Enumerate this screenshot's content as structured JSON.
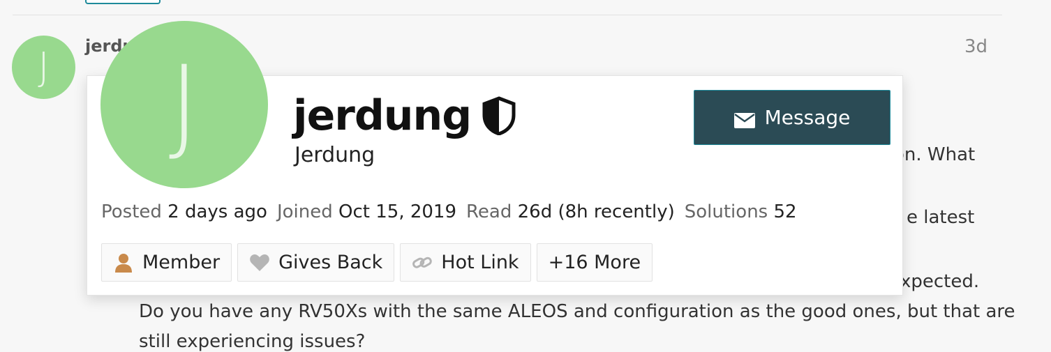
{
  "post": {
    "avatar_letter": "J",
    "username": "jerdung",
    "time": "3d",
    "body_lines": [
      "on. What",
      "e latest",
      "xpected.",
      "Do you have any RV50Xs with the same ALEOS and configuration as the good ones, but that are",
      "still experiencing issues?"
    ]
  },
  "user_card": {
    "avatar_letter": "J",
    "username": "jerdung",
    "full_name": "Jerdung",
    "message_label": "Message",
    "stats": {
      "posted_label": "Posted",
      "posted_value": "2 days ago",
      "joined_label": "Joined",
      "joined_value": "Oct 15, 2019",
      "read_label": "Read",
      "read_value": "26d (8h recently)",
      "solutions_label": "Solutions",
      "solutions_value": "52"
    },
    "badges": [
      {
        "label": "Member",
        "icon": "person-icon",
        "color": "#c98a4b"
      },
      {
        "label": "Gives Back",
        "icon": "heart-icon",
        "color": "#b5b5b5"
      },
      {
        "label": "Hot Link",
        "icon": "link-icon",
        "color": "#b5b5b5"
      },
      {
        "label": "+16 More"
      }
    ]
  },
  "colors": {
    "avatar": "#98d98e",
    "message_button": "#2b4b55",
    "accent": "#1e8a9a"
  }
}
